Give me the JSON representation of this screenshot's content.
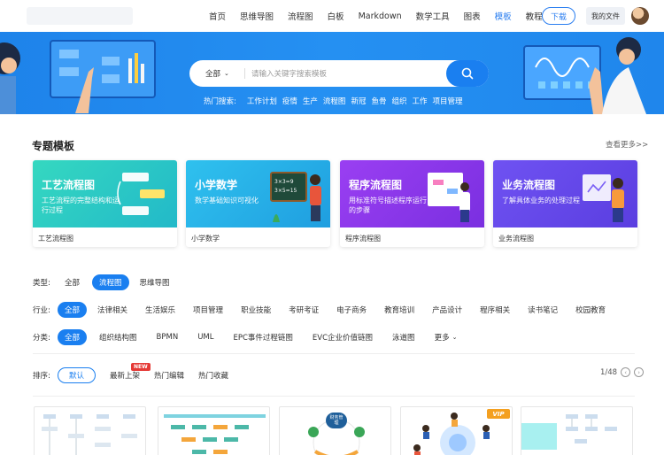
{
  "nav": {
    "links": [
      "首页",
      "思维导图",
      "流程图",
      "白板",
      "Markdown",
      "数学工具",
      "图表",
      "模板",
      "教程"
    ],
    "active_index": 7,
    "download": "下载",
    "my_files": "我的文件",
    "accent": "#2a7ef0"
  },
  "search": {
    "category": "全部",
    "placeholder": "请输入关键字搜索模板",
    "hot_label": "热门搜索:",
    "hot_terms": [
      "工作计划",
      "疫情",
      "生产",
      "流程图",
      "新冠",
      "鱼骨",
      "组织",
      "工作",
      "项目管理"
    ]
  },
  "section": {
    "title": "专题模板",
    "see_more": "查看更多>>"
  },
  "cards": [
    {
      "title": "工艺流程图",
      "subtitle": "工艺流程的完整结构和运行过程",
      "caption": "工艺流程图",
      "color": "#2fd1b8"
    },
    {
      "title": "小学数学",
      "subtitle": "数学基础知识可视化",
      "caption": "小学数学",
      "color": "#2fb3e8"
    },
    {
      "title": "程序流程图",
      "subtitle": "用标准符号描述程序运行的步骤",
      "caption": "程序流程图",
      "color": "#8a3ff0"
    },
    {
      "title": "业务流程图",
      "subtitle": "了解具体业务的处理过程",
      "caption": "业务流程图",
      "color": "#6a4ff0"
    }
  ],
  "filters": {
    "type_label": "类型:",
    "types": [
      "全部",
      "流程图",
      "思维导图"
    ],
    "type_active": 1,
    "industry_label": "行业:",
    "industries": [
      "全部",
      "法律相关",
      "生活娱乐",
      "项目管理",
      "职业技能",
      "考研考证",
      "电子商务",
      "教育培训",
      "产品设计",
      "程序相关",
      "读书笔记",
      "校园教育"
    ],
    "industry_active": 0,
    "category_label": "分类:",
    "categories": [
      "全部",
      "组织结构图",
      "BPMN",
      "UML",
      "EPC事件过程链图",
      "EVC企业价值链图",
      "泳道图",
      "更多"
    ],
    "category_active": 0,
    "sort_label": "排序:",
    "sorts": [
      "默认",
      "最新上架",
      "热门编辑",
      "热门收藏"
    ],
    "sort_active": 0,
    "new_badge": "NEW",
    "page": "1/48"
  },
  "thumbs": {
    "vip": "VIP",
    "center_label": "财务管理"
  }
}
